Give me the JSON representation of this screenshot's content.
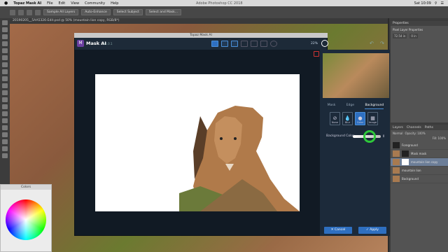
{
  "menubar": {
    "apple": "",
    "app_name": "Topaz Mask AI",
    "items": [
      "File",
      "Edit",
      "View",
      "Community",
      "Help"
    ],
    "window_title": "Adobe Photoshop CC 2018",
    "clock": "Sat 10:09"
  },
  "options_bar": {
    "sample_all_layers": "Sample All Layers",
    "auto_enhance": "Auto-Enhance",
    "select_subject": "Select Subject",
    "select_and_mask": "Select and Mask..."
  },
  "document_tab": "20190205__5AA5326-Edit.psd @ 50% (mountain lion copy, RGB/8*)",
  "colors_panel": {
    "title": "Colors"
  },
  "properties_panel": {
    "title": "Properties",
    "subtitle": "Pixel Layer Properties",
    "w_value": "72.54 in",
    "x_value": "0 in"
  },
  "layers_panel": {
    "tabs": [
      "Layers",
      "Channels",
      "Paths"
    ],
    "blend_mode": "Normal",
    "opacity": "Opacity: 100%",
    "fill": "Fill: 100%",
    "layers": [
      {
        "name": "Foreground"
      },
      {
        "name": "Mask mask"
      },
      {
        "name": "mountain lion copy"
      },
      {
        "name": "mountain lion"
      },
      {
        "name": "Background"
      }
    ]
  },
  "topaz": {
    "window_title": "Topaz Mask AI",
    "name": "Mask AI",
    "version": "v1.0.1",
    "zoom": "22%",
    "tabs": [
      "Mask",
      "Edge",
      "Background"
    ],
    "active_tab": "Background",
    "bg_options": [
      "None",
      "Blur",
      "Color",
      "Image"
    ],
    "selected_bg": "Color",
    "background_color_label": "Background Color",
    "background_color": "#ffffff",
    "cancel_label": "Cancel",
    "apply_label": "Apply"
  },
  "colors": {
    "accent": "#2e6fc0",
    "highlight_ring": "#2ec83a"
  }
}
